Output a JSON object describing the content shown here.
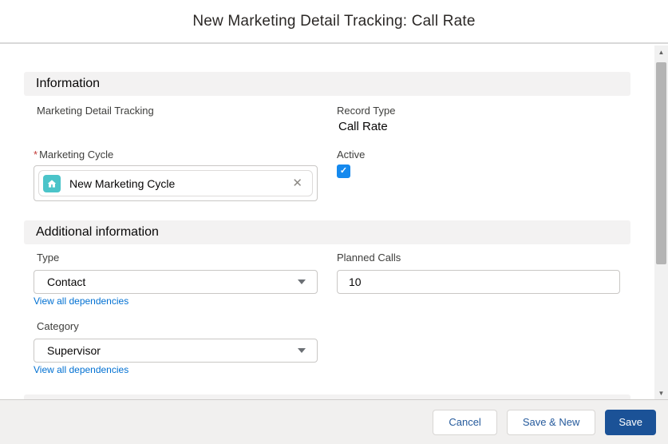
{
  "header": {
    "title": "New Marketing Detail Tracking: Call Rate"
  },
  "info": {
    "heading": "Information",
    "marketing_detail_tracking_label": "Marketing Detail Tracking",
    "record_type_label": "Record Type",
    "record_type_value": "Call Rate",
    "required_mark": "*",
    "marketing_cycle_label": "Marketing Cycle",
    "marketing_cycle_pill_text": "New Marketing Cycle",
    "active_label": "Active",
    "active_checked": true
  },
  "additional": {
    "heading": "Additional information",
    "type_label": "Type",
    "type_value": "Contact",
    "planned_calls_label": "Planned Calls",
    "planned_calls_value": "10",
    "category_label": "Category",
    "category_value": "Supervisor",
    "dependency_link_label": "View all dependencies"
  },
  "footer": {
    "cancel_label": "Cancel",
    "save_and_new_label": "Save & New",
    "save_label": "Save"
  },
  "icons": {
    "check": "✓",
    "close": "✕",
    "scroll_up": "▲",
    "scroll_down": "▼"
  },
  "colors": {
    "link_blue": "#0070d2",
    "brand_button_blue": "#1b5297",
    "checkbox_blue": "#1589ee",
    "record_icon_teal": "#4bc4c9",
    "required_red": "#c23934",
    "section_bar_gray": "#f3f2f2"
  }
}
